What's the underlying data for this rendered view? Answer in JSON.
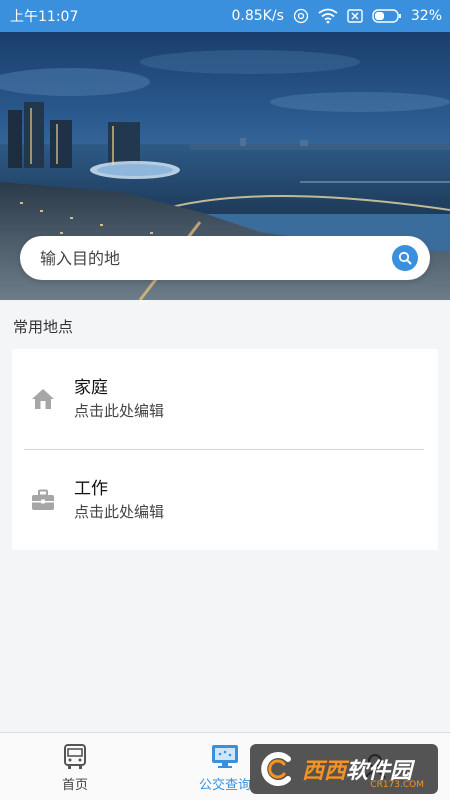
{
  "status_bar": {
    "time": "上午11:07",
    "speed": "0.85K/s",
    "battery": "32%"
  },
  "search": {
    "placeholder": "输入目的地"
  },
  "common_places": {
    "title": "常用地点",
    "items": [
      {
        "name": "家庭",
        "hint": "点击此处编辑",
        "icon": "house-icon"
      },
      {
        "name": "工作",
        "hint": "点击此处编辑",
        "icon": "briefcase-icon"
      }
    ]
  },
  "bottom_nav": {
    "items": [
      {
        "label": "首页",
        "icon": "bus-icon",
        "active": false
      },
      {
        "label": "公交查询",
        "icon": "monitor-icon",
        "active": true
      },
      {
        "label": "",
        "icon": "user-icon",
        "active": false
      }
    ]
  },
  "watermark": {
    "text_a": "西西",
    "text_b": "软件园",
    "sub": "CR173.COM"
  },
  "colors": {
    "accent": "#3a90dd",
    "background": "#f3f5f7",
    "icon_gray": "#a6a6a6"
  }
}
